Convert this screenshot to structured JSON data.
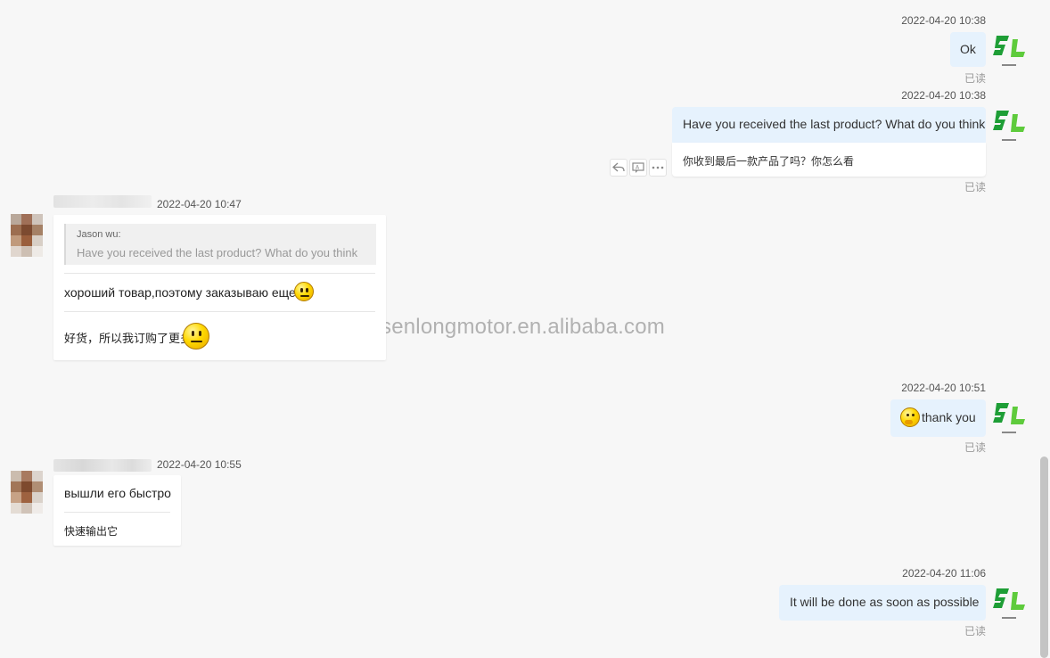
{
  "watermark": "senlongmotor.en.alibaba.com",
  "read_label": "已读",
  "actions": {
    "reply_icon": "reply-icon",
    "translate_icon": "translate-icon",
    "more_icon": "more-icon"
  },
  "messages": [
    {
      "direction": "out",
      "time": "2022-04-20 10:38",
      "text": "Ok",
      "read": "已读"
    },
    {
      "direction": "out",
      "time": "2022-04-20 10:38",
      "text": "Have you received the last product? What do you think",
      "translation": "你收到最后一款产品了吗？你怎么看",
      "read": "已读"
    },
    {
      "direction": "in",
      "time": "2022-04-20 10:47",
      "quote_author": "Jason wu:",
      "quote_text": "Have you received the last product? What do you think",
      "text": "хороший товар,поэтому заказываю еще",
      "translation": "好货，所以我订购了更多"
    },
    {
      "direction": "out",
      "time": "2022-04-20 10:51",
      "text": "thank you",
      "read": "已读"
    },
    {
      "direction": "in",
      "time": "2022-04-20 10:55",
      "text": "вышли его быстро",
      "translation": "快速输出它"
    },
    {
      "direction": "out",
      "time": "2022-04-20 11:06",
      "text": "It will be done as soon as possible",
      "read": "已读"
    }
  ],
  "colors": {
    "outgoing_bubble": "#e6f2fd",
    "incoming_bubble": "#ffffff",
    "logo_green": "#2fb344"
  }
}
